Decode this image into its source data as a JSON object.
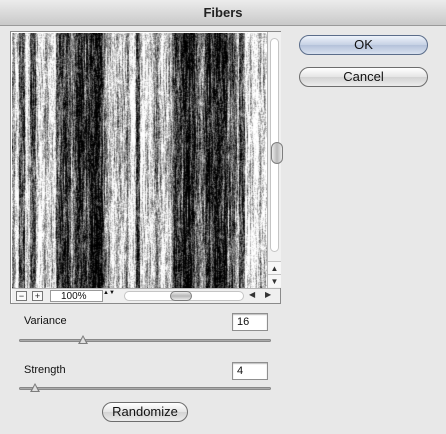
{
  "window": {
    "title": "Fibers"
  },
  "buttons": {
    "ok": "OK",
    "cancel": "Cancel",
    "randomize": "Randomize"
  },
  "preview": {
    "zoom": "100%",
    "icons": {
      "zoom_out": "minus-icon",
      "zoom_in": "plus-icon",
      "scroll_up": "up-arrow-icon",
      "scroll_down": "down-arrow-icon",
      "scroll_left": "left-arrow-icon",
      "scroll_right": "right-arrow-icon"
    },
    "glyphs": {
      "zoom_out": "−",
      "zoom_in": "+",
      "up": "▲",
      "down": "▼",
      "left": "◀",
      "right": "▶",
      "stepper": "▲▼"
    }
  },
  "controls": {
    "variance": {
      "label": "Variance",
      "value": "16",
      "slider_fraction": 0.25
    },
    "strength": {
      "label": "Strength",
      "value": "4",
      "slider_fraction": 0.06
    }
  }
}
